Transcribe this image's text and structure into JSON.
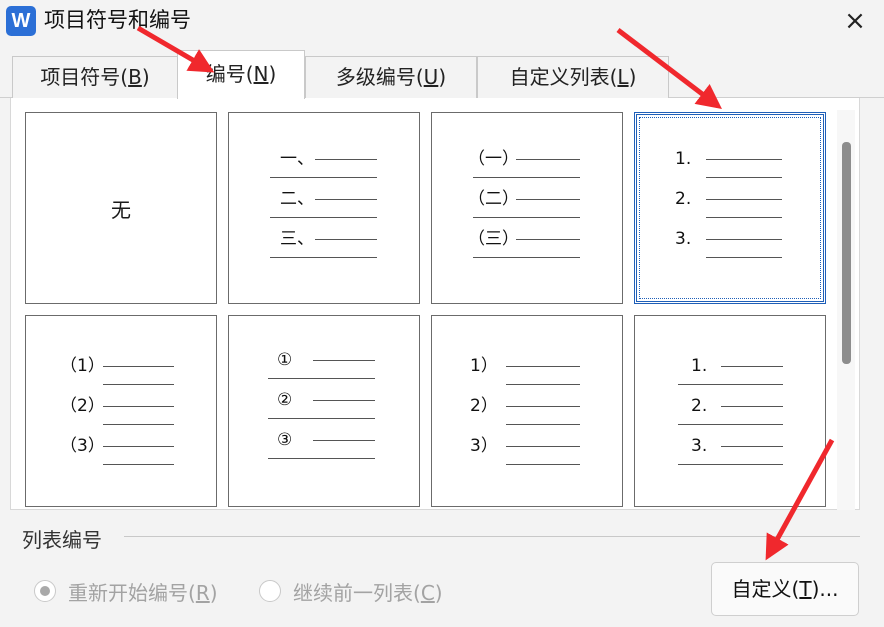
{
  "window": {
    "app_icon": "W",
    "title": "项目符号和编号",
    "close_icon": "×"
  },
  "tabs": [
    {
      "text": "项目符号(",
      "key": "B",
      "end": ")",
      "active": false
    },
    {
      "text": "编号(",
      "key": "N",
      "end": ")",
      "active": true
    },
    {
      "text": "多级编号(",
      "key": "U",
      "end": ")",
      "active": false
    },
    {
      "text": "自定义列表(",
      "key": "L",
      "end": ")",
      "active": false
    }
  ],
  "gallery": {
    "none_label": "无",
    "styles": [
      {
        "markers": []
      },
      {
        "markers": [
          "一、",
          "二、",
          "三、"
        ]
      },
      {
        "markers": [
          "（一）",
          "（二）",
          "（三）"
        ]
      },
      {
        "markers": [
          "1.",
          "2.",
          "3."
        ],
        "selected": true
      },
      {
        "markers": [
          "（1）",
          "（2）",
          "（3）"
        ]
      },
      {
        "markers": [
          "①",
          "②",
          "③"
        ]
      },
      {
        "markers": [
          "1）",
          "2）",
          "3）"
        ]
      },
      {
        "markers": [
          "1.",
          "2.",
          "3."
        ]
      }
    ]
  },
  "list_numbering": {
    "section_label": "列表编号",
    "restart": {
      "text": "重新开始编号(",
      "key": "R",
      "end": ")",
      "checked": true
    },
    "continue": {
      "text": "继续前一列表(",
      "key": "C",
      "end": ")",
      "checked": false
    },
    "customize": {
      "text": "自定义(",
      "key": "T",
      "end": ")..."
    }
  },
  "colors": {
    "annotation_arrow": "#f0282d",
    "selection": "#1f5fb8"
  }
}
